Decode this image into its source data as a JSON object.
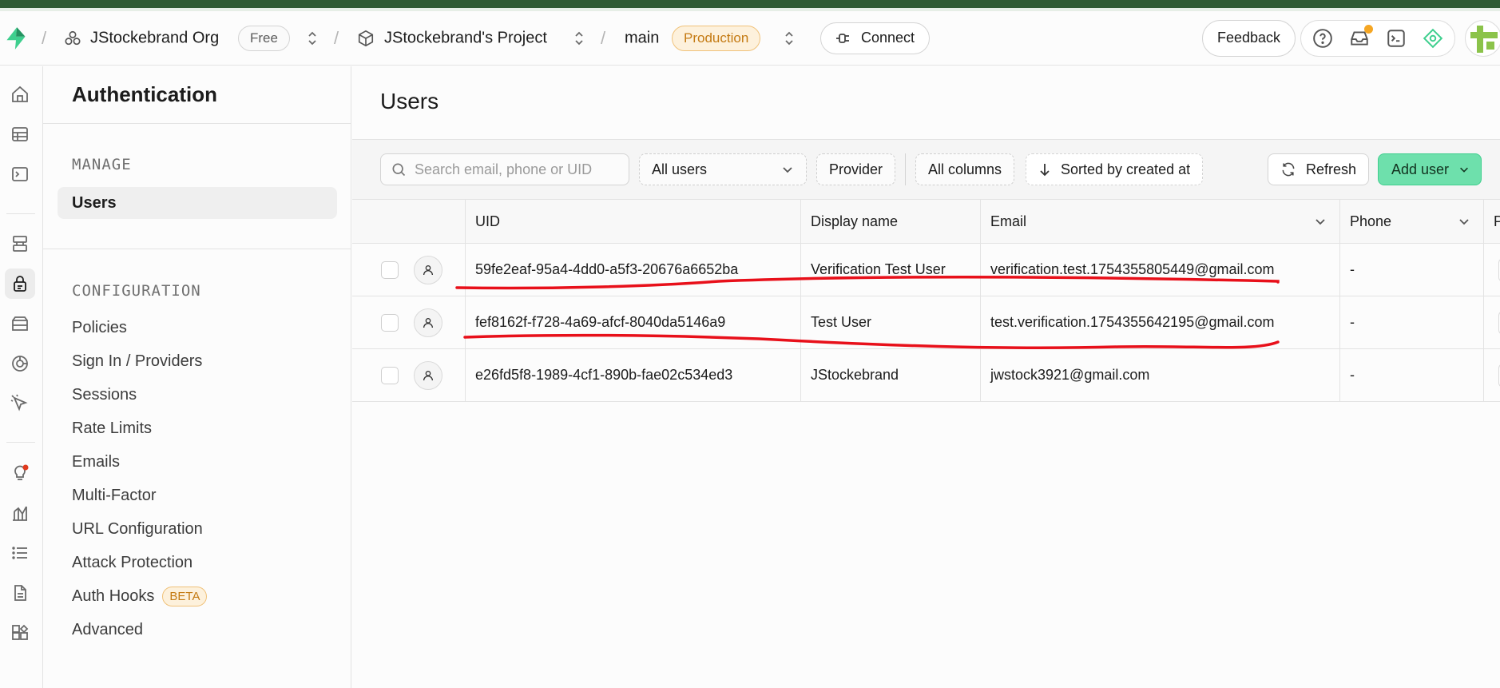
{
  "topbar": {
    "org_name": "JStockebrand Org",
    "plan_badge": "Free",
    "project_name": "JStockebrand's Project",
    "branch_name": "main",
    "env_badge": "Production",
    "connect_label": "Connect",
    "feedback_label": "Feedback",
    "separator": "/"
  },
  "sidebar": {
    "title": "Authentication",
    "manage_heading": "MANAGE",
    "manage_items": [
      {
        "label": "Users"
      }
    ],
    "config_heading": "CONFIGURATION",
    "config_items": [
      {
        "label": "Policies"
      },
      {
        "label": "Sign In / Providers"
      },
      {
        "label": "Sessions"
      },
      {
        "label": "Rate Limits"
      },
      {
        "label": "Emails"
      },
      {
        "label": "Multi-Factor"
      },
      {
        "label": "URL Configuration"
      },
      {
        "label": "Attack Protection"
      },
      {
        "label": "Auth Hooks",
        "badge": "BETA"
      },
      {
        "label": "Advanced"
      }
    ]
  },
  "main": {
    "title": "Users",
    "search": {
      "placeholder": "Search email, phone or UID",
      "value": ""
    },
    "filter_select": "All users",
    "provider_label": "Provider",
    "columns_label": "All columns",
    "sort_label": "Sorted by created at",
    "refresh_label": "Refresh",
    "add_user_label": "Add user"
  },
  "table": {
    "headers": {
      "uid": "UID",
      "display_name": "Display name",
      "email": "Email",
      "phone": "Phone",
      "provider_cut": "P"
    },
    "rows": [
      {
        "uid": "59fe2eaf-95a4-4dd0-a5f3-20676a6652ba",
        "display_name": "Verification Test User",
        "email": "verification.test.1754355805449@gmail.com",
        "phone": "-"
      },
      {
        "uid": "fef8162f-f728-4a69-afcf-8040da5146a9",
        "display_name": "Test User",
        "email": "test.verification.1754355642195@gmail.com",
        "phone": "-"
      },
      {
        "uid": "e26fd5f8-1989-4cf1-890b-fae02c534ed3",
        "display_name": "JStockebrand",
        "email": "jwstock3921@gmail.com",
        "phone": "-"
      }
    ]
  },
  "colors": {
    "brand_green": "#3ecf8e",
    "annotation_red": "#e8101a",
    "warning_orange": "#f5a623"
  }
}
